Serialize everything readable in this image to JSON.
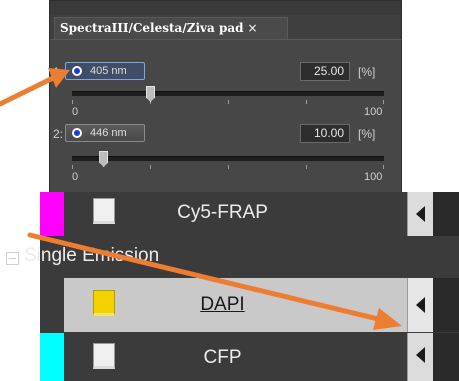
{
  "pad": {
    "tab_label": "SpectraIII/Celesta/Ziva pad",
    "tab_close": "×",
    "lasers": [
      {
        "index": "1:",
        "wavelength": "405 nm",
        "power": "25.00",
        "unit": "[%]",
        "selected": true,
        "slider_level": 0.25
      },
      {
        "index": "2:",
        "wavelength": "446 nm",
        "power": "10.00",
        "unit": "[%]",
        "selected": false,
        "slider_level": 0.1
      }
    ],
    "scale_min": "0",
    "scale_max": "100",
    "radio_color": "#1a3ae0"
  },
  "filters": {
    "items": [
      {
        "name": "Cy5-FRAP",
        "swatch_color": "#ff00ff",
        "icon_color": "#f0f0f0"
      }
    ],
    "group": {
      "label": "Single Emission"
    },
    "group_items": [
      {
        "name": "DAPI",
        "swatch_color": "",
        "icon_color": "#f3d200",
        "selected": true
      },
      {
        "name": "CFP",
        "swatch_color": "#00ffff",
        "icon_color": "#f0f0f0"
      }
    ]
  },
  "annotations": {
    "arrow_color": "#ed7d31"
  }
}
